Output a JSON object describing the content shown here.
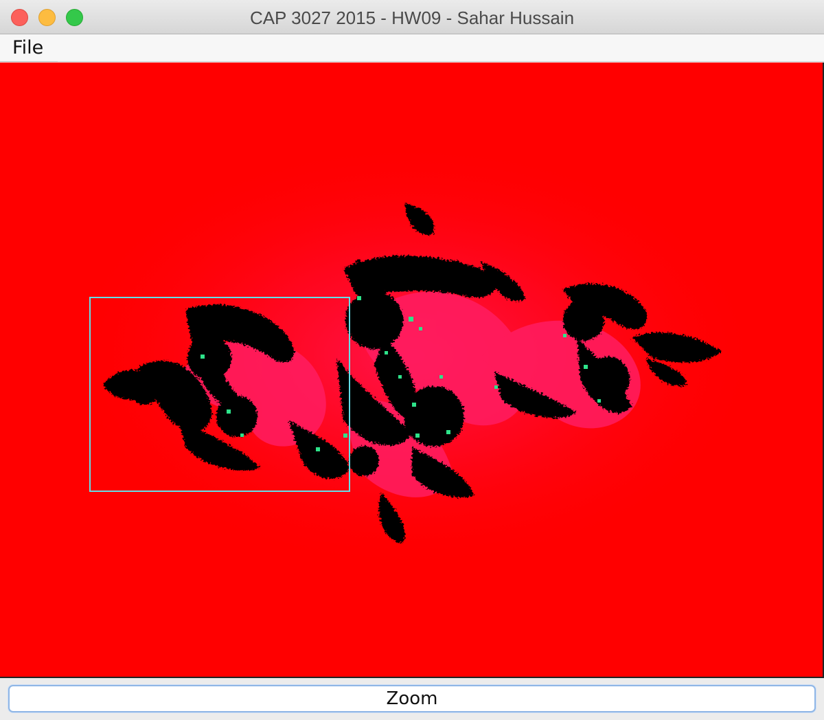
{
  "window": {
    "title": "CAP 3027 2015 - HW09 - Sahar Hussain"
  },
  "menubar": {
    "items": [
      {
        "label": "File"
      }
    ]
  },
  "canvas": {
    "description_icon": "julia-set-fractal",
    "background_color": "#ff0000",
    "fractal_colors": {
      "interior": "#000000",
      "glow": "#ff1f5a",
      "edge": "#2ee38a"
    },
    "selection_color": "#62e0e8"
  },
  "bottom": {
    "zoom_label": "Zoom"
  }
}
